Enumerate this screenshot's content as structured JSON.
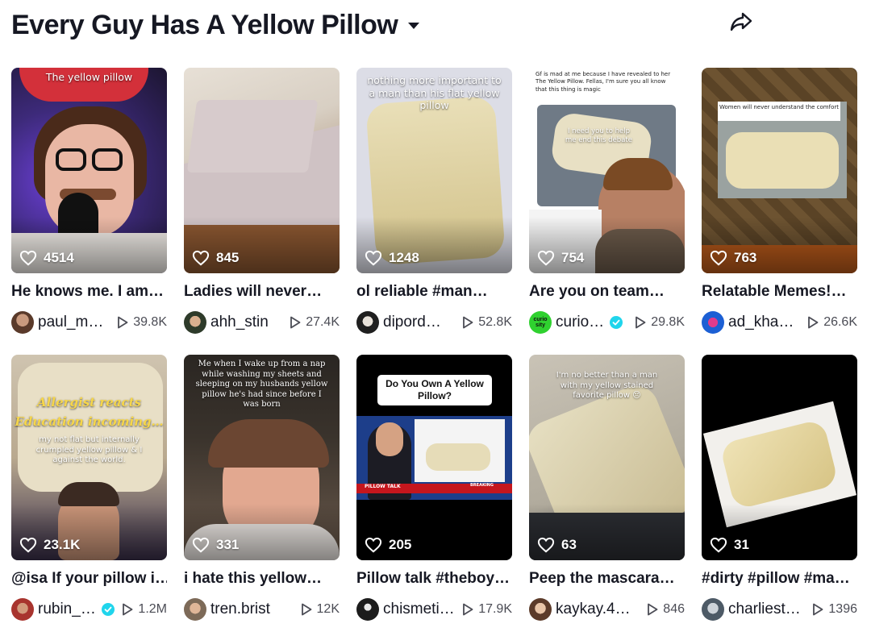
{
  "header": {
    "title": "Every Guy Has A Yellow Pillow"
  },
  "videos": [
    {
      "likes": "4514",
      "caption": "He knows me. I am…",
      "username": "paul_m…",
      "views": "39.8K",
      "verified": false,
      "overlay": "The yellow pillow"
    },
    {
      "likes": "845",
      "caption": "Ladies will never…",
      "username": "ahh_stin",
      "views": "27.4K",
      "verified": false,
      "overlay": ""
    },
    {
      "likes": "1248",
      "caption": "ol reliable #man…",
      "username": "dipord…",
      "views": "52.8K",
      "verified": false,
      "overlay": "nothing more important to a man than his flat yellow pillow"
    },
    {
      "likes": "754",
      "caption": "Are you on team…",
      "username": "curio…",
      "views": "29.8K",
      "verified": true,
      "overlay": "Gf is mad at me because I have revealed to her The Yellow Pillow. Fellas, I'm sure you all know that this thing is magic",
      "overlay2": "I need you to help me end this debate",
      "avatar_text": "curio sity"
    },
    {
      "likes": "763",
      "caption": "Relatable Memes!…",
      "username": "ad_kha…",
      "views": "26.6K",
      "verified": false,
      "overlay": "Women will never understand the comfort"
    },
    {
      "likes": "23.1K",
      "caption": "@isa If your pillow i…",
      "username": "rubin_…",
      "views": "1.2M",
      "verified": true,
      "overlay": "Allergist reacts",
      "overlay2": "Education incoming…",
      "overlay3": "my not flat but internally crumpled yellow pillow & I against the world."
    },
    {
      "likes": "331",
      "caption": "i hate this yellow…",
      "username": "tren.brist",
      "views": "12K",
      "verified": false,
      "overlay": "Me when I wake up from a nap while washing my sheets and sleeping on my husbands yellow pillow he's had since before I was born"
    },
    {
      "likes": "205",
      "caption": "Pillow talk #theboy…",
      "username": "chismeti…",
      "views": "17.9K",
      "verified": false,
      "overlay": "Do You Own A Yellow Pillow?",
      "overlay2": "PILLOW TALK",
      "overlay3": "BREAKING"
    },
    {
      "likes": "63",
      "caption": "Peep the mascara…",
      "username": "kaykay.4…",
      "views": "846",
      "verified": false,
      "overlay": "I'm no better than a man with my yellow stained favorite pillow 😔"
    },
    {
      "likes": "31",
      "caption": "#dirty #pillow #ma…",
      "username": "charliest…",
      "views": "1396",
      "verified": false,
      "overlay": ""
    }
  ],
  "colors": {
    "verified": "#20d5ec",
    "text": "#161823",
    "muted": "#4b4c55"
  },
  "icons": {
    "title_caret": "caret-down-icon",
    "share": "share-arrow-icon",
    "likes": "heart-outline-icon",
    "views": "play-outline-icon",
    "verified": "verified-badge-icon"
  }
}
